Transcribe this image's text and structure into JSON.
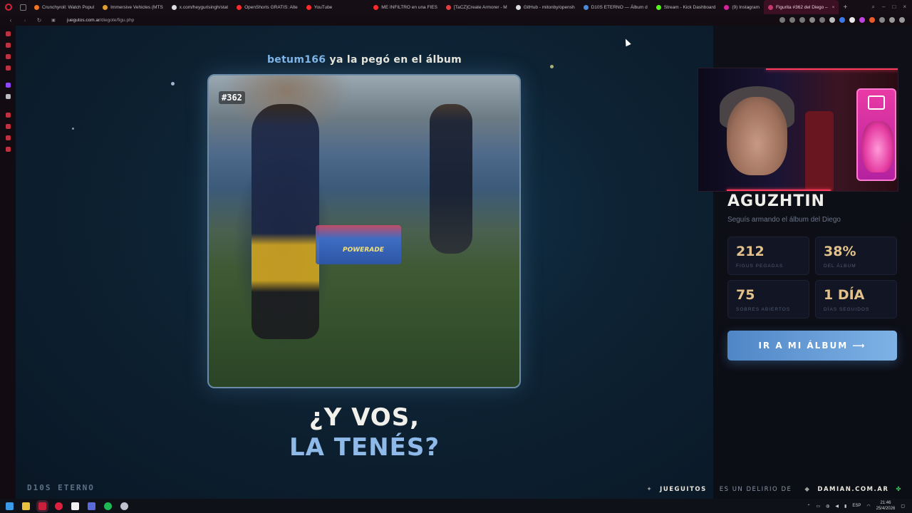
{
  "browser": {
    "tabs": [
      {
        "label": "Crunchyroll: Watch Popul",
        "color": "#f47521"
      },
      {
        "label": "Immersive Vehicles (MTS",
        "color": "#e0a030"
      },
      {
        "label": "x.com/heygurisingh/stat",
        "color": "#dddddd"
      },
      {
        "label": "OpenShorts GRATIS: Alte",
        "color": "#ff2a2a"
      },
      {
        "label": "YouTube",
        "color": "#ff2a2a"
      },
      {
        "label": "ME INFILTRO en una FIES",
        "color": "#ff2a2a"
      },
      {
        "label": "[TaCZ]Create Armorer - M",
        "color": "#e04040"
      },
      {
        "label": "GitHub - mitonby/opensh",
        "color": "#dddddd"
      },
      {
        "label": "D10S ETERNO — Álbum d",
        "color": "#4a8ad8"
      },
      {
        "label": "Stream - Kick Dashboard",
        "color": "#53fc18"
      },
      {
        "label": "(9) Instagram",
        "color": "#d6249f"
      },
      {
        "label": "Figurita #362 del Diego –",
        "color": "#c23a6a",
        "active": true
      }
    ],
    "url_domain": "juegutos.com.ar",
    "url_path": "/diegote/figu.php"
  },
  "stage": {
    "username": "betum166",
    "headline_rest": " ya la pegó en el álbum",
    "sticker_number": "#362",
    "cooler_label": "POWERADE",
    "question_line1": "¿Y VOS,",
    "question_line2": "LA TENÉS?",
    "brand": "D10S ETERNO"
  },
  "profile": {
    "name": "AGUZHTIN",
    "subtitle": "Seguís armando el álbum del Diego",
    "stats": [
      {
        "value": "212",
        "label": "FIGUS PEGADAS"
      },
      {
        "value": "38%",
        "label": "DEL ÁLBUM"
      },
      {
        "value": "75",
        "label": "SOBRES ABIERTOS"
      },
      {
        "value": "1 DÍA",
        "label": "DÍAS SEGUIDOS"
      }
    ],
    "cta": "IR A MI ÁLBUM ⟶"
  },
  "footer": {
    "site1": "JUEGUITOS",
    "middle": "ES UN DELIRIO DE",
    "site2": "DAMIAN.COM.AR"
  },
  "taskbar": {
    "lang": "ESP",
    "time": "21:46",
    "date": "25/4/2026"
  }
}
